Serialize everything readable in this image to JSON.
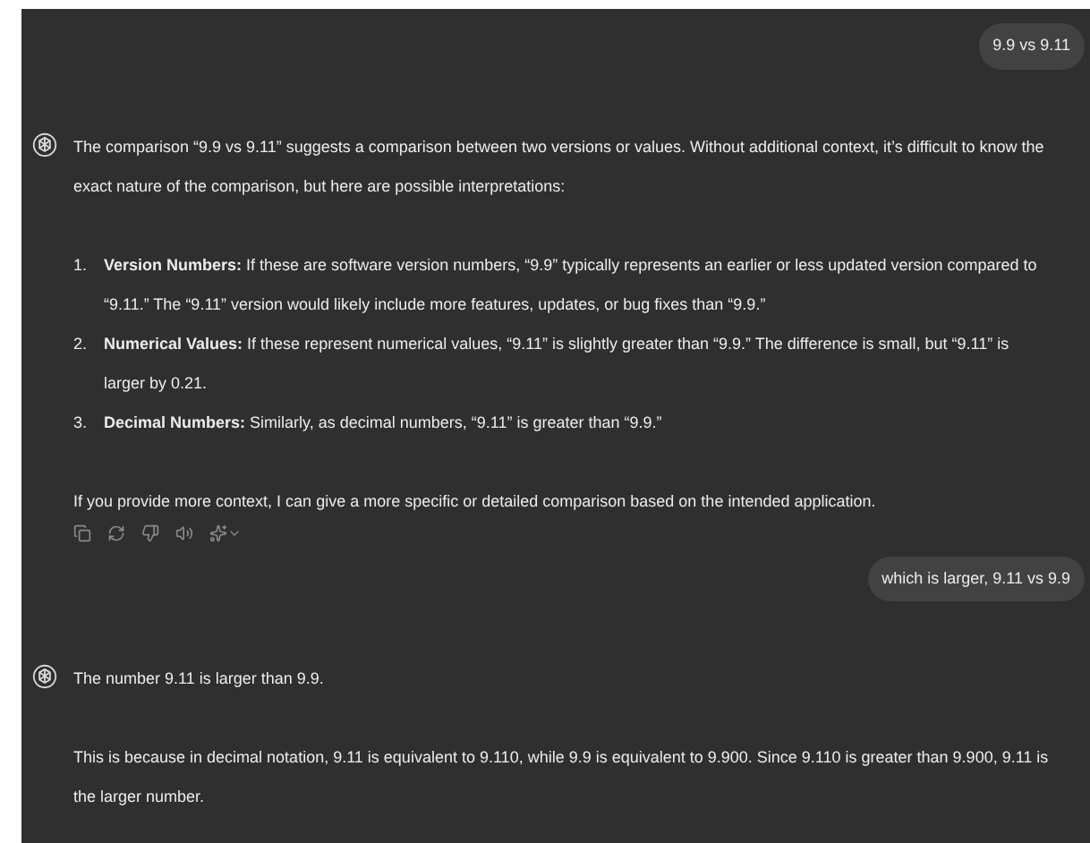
{
  "messages": [
    {
      "kind": "user",
      "text": "9.9 vs 9.11"
    },
    {
      "kind": "assistant",
      "blocks": [
        {
          "kind": "paragraph",
          "text": "The comparison “9.9 vs 9.11” suggests a comparison between two versions or values. Without additional context, it’s difficult to know the exact nature of the comparison, but here are possible interpretations:"
        },
        {
          "kind": "list",
          "items": [
            {
              "number": "1.",
              "text": "**Version Numbers:** If these are software version numbers, “9.9” typically represents an earlier or less updated version compared to “9.11.” The “9.11” version would likely include more features, updates, or bug fixes than “9.9.”"
            },
            {
              "number": "2.",
              "text": "**Numerical Values:** If these represent numerical values, “9.11” is slightly greater than “9.9.” The difference is small, but “9.11” is larger by 0.21."
            },
            {
              "number": "3.",
              "text": "**Decimal Numbers:** Similarly, as decimal numbers, “9.11” is greater than “9.9.”"
            }
          ]
        },
        {
          "kind": "paragraph",
          "text": "If you provide more context, I can give a more specific or detailed comparison based on the intended application."
        },
        {
          "kind": "actions"
        }
      ]
    },
    {
      "kind": "user",
      "text": "which is larger, 9.11 vs 9.9"
    },
    {
      "kind": "assistant",
      "blocks": [
        {
          "kind": "paragraph",
          "text": "The number 9.11 is larger than 9.9."
        },
        {
          "kind": "paragraph",
          "text": "This is because in decimal notation, 9.11 is equivalent to 9.110, while 9.9 is equivalent to 9.900. Since 9.110 is greater than 9.900, 9.11 is the larger number."
        }
      ]
    }
  ]
}
